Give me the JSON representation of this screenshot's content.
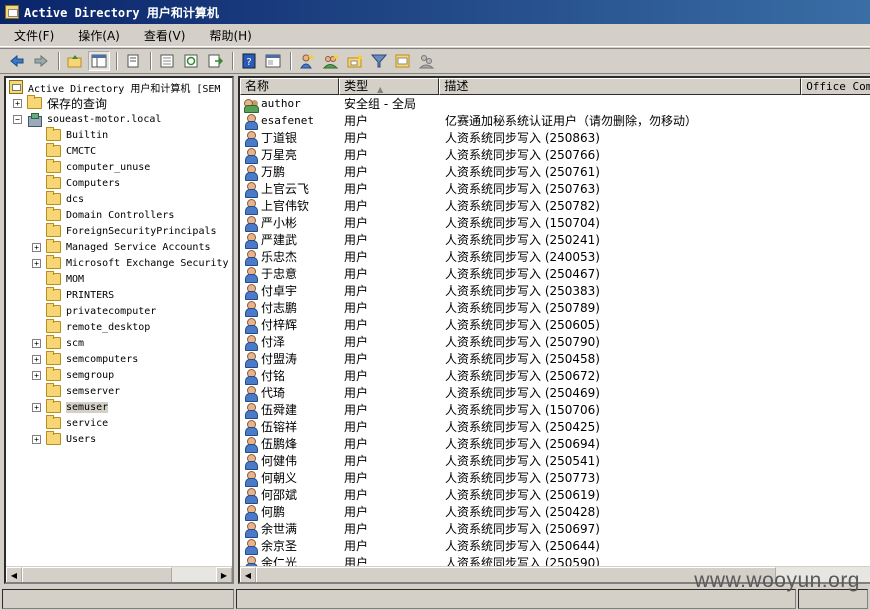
{
  "window": {
    "title": "Active Directory 用户和计算机"
  },
  "menu": [
    "文件(F)",
    "操作(A)",
    "查看(V)",
    "帮助(H)"
  ],
  "toolbar": {
    "buttons": [
      "back-arrow-icon",
      "forward-arrow-icon",
      "up-folder-icon",
      "show-tree-icon",
      "copy-icon",
      "properties-icon",
      "refresh-icon",
      "export-list-icon",
      "help-icon",
      "console-icon",
      "new-user-icon",
      "new-group-icon",
      "new-ou-icon",
      "filter-icon",
      "find-icon",
      "add-to-group-icon"
    ]
  },
  "tree": {
    "root": "Active Directory 用户和计算机 [SEM",
    "saved_queries": "保存的查询",
    "domain": "soueast-motor.local",
    "items": [
      {
        "label": "Builtin",
        "expandable": false
      },
      {
        "label": "CMCTC",
        "expandable": false
      },
      {
        "label": "computer_unuse",
        "expandable": false
      },
      {
        "label": "Computers",
        "expandable": false
      },
      {
        "label": "dcs",
        "expandable": false
      },
      {
        "label": "Domain Controllers",
        "expandable": false
      },
      {
        "label": "ForeignSecurityPrincipals",
        "expandable": false
      },
      {
        "label": "Managed Service Accounts",
        "expandable": true
      },
      {
        "label": "Microsoft Exchange Security",
        "expandable": true
      },
      {
        "label": "MOM",
        "expandable": false
      },
      {
        "label": "PRINTERS",
        "expandable": false
      },
      {
        "label": "privatecomputer",
        "expandable": false
      },
      {
        "label": "remote_desktop",
        "expandable": false
      },
      {
        "label": "scm",
        "expandable": true
      },
      {
        "label": "semcomputers",
        "expandable": true
      },
      {
        "label": "semgroup",
        "expandable": true
      },
      {
        "label": "semserver",
        "expandable": false
      },
      {
        "label": "semuser",
        "expandable": true,
        "selected": true
      },
      {
        "label": "service",
        "expandable": false
      },
      {
        "label": "Users",
        "expandable": true
      }
    ]
  },
  "list": {
    "columns": [
      "名称",
      "类型",
      "描述",
      "Office Comm"
    ],
    "rows": [
      {
        "name": "author",
        "type": "安全组 - 全局",
        "desc": "",
        "icon": "group"
      },
      {
        "name": "esafenet",
        "type": "用户",
        "desc": "亿赛通加秘系统认证用户（请勿删除，勿移动）",
        "icon": "user"
      },
      {
        "name": "丁道银",
        "type": "用户",
        "desc": "人资系统同步写入 (250863)",
        "icon": "user"
      },
      {
        "name": "万星亮",
        "type": "用户",
        "desc": "人资系统同步写入 (250766)",
        "icon": "user"
      },
      {
        "name": "万鹏",
        "type": "用户",
        "desc": "人资系统同步写入 (250761)",
        "icon": "user"
      },
      {
        "name": "上官云飞",
        "type": "用户",
        "desc": "人资系统同步写入 (250763)",
        "icon": "user"
      },
      {
        "name": "上官伟钦",
        "type": "用户",
        "desc": "人资系统同步写入 (250782)",
        "icon": "user"
      },
      {
        "name": "严小彬",
        "type": "用户",
        "desc": "人资系统同步写入 (150704)",
        "icon": "user"
      },
      {
        "name": "严建武",
        "type": "用户",
        "desc": "人资系统同步写入 (250241)",
        "icon": "user"
      },
      {
        "name": "乐忠杰",
        "type": "用户",
        "desc": "人资系统同步写入 (240053)",
        "icon": "user"
      },
      {
        "name": "于忠意",
        "type": "用户",
        "desc": "人资系统同步写入 (250467)",
        "icon": "user"
      },
      {
        "name": "付卓宇",
        "type": "用户",
        "desc": "人资系统同步写入 (250383)",
        "icon": "user"
      },
      {
        "name": "付志鹏",
        "type": "用户",
        "desc": "人资系统同步写入 (250789)",
        "icon": "user"
      },
      {
        "name": "付梓辉",
        "type": "用户",
        "desc": "人资系统同步写入 (250605)",
        "icon": "user"
      },
      {
        "name": "付泽",
        "type": "用户",
        "desc": "人资系统同步写入 (250790)",
        "icon": "user"
      },
      {
        "name": "付盟涛",
        "type": "用户",
        "desc": "人资系统同步写入 (250458)",
        "icon": "user"
      },
      {
        "name": "付铭",
        "type": "用户",
        "desc": "人资系统同步写入 (250672)",
        "icon": "user"
      },
      {
        "name": "代琦",
        "type": "用户",
        "desc": "人资系统同步写入 (250469)",
        "icon": "user"
      },
      {
        "name": "伍舜建",
        "type": "用户",
        "desc": "人资系统同步写入 (150706)",
        "icon": "user"
      },
      {
        "name": "伍镕祥",
        "type": "用户",
        "desc": "人资系统同步写入 (250425)",
        "icon": "user"
      },
      {
        "name": "伍鹏烽",
        "type": "用户",
        "desc": "人资系统同步写入 (250694)",
        "icon": "user"
      },
      {
        "name": "何健伟",
        "type": "用户",
        "desc": "人资系统同步写入 (250541)",
        "icon": "user"
      },
      {
        "name": "何朝义",
        "type": "用户",
        "desc": "人资系统同步写入 (250773)",
        "icon": "user"
      },
      {
        "name": "何邵斌",
        "type": "用户",
        "desc": "人资系统同步写入 (250619)",
        "icon": "user"
      },
      {
        "name": "何鹏",
        "type": "用户",
        "desc": "人资系统同步写入 (250428)",
        "icon": "user"
      },
      {
        "name": "余世满",
        "type": "用户",
        "desc": "人资系统同步写入 (250697)",
        "icon": "user"
      },
      {
        "name": "余京圣",
        "type": "用户",
        "desc": "人资系统同步写入 (250644)",
        "icon": "user"
      },
      {
        "name": "余仁光",
        "type": "用户",
        "desc": "人资系统同步写入 (250590)",
        "icon": "user"
      }
    ]
  },
  "watermark": "www.wooyun.org"
}
